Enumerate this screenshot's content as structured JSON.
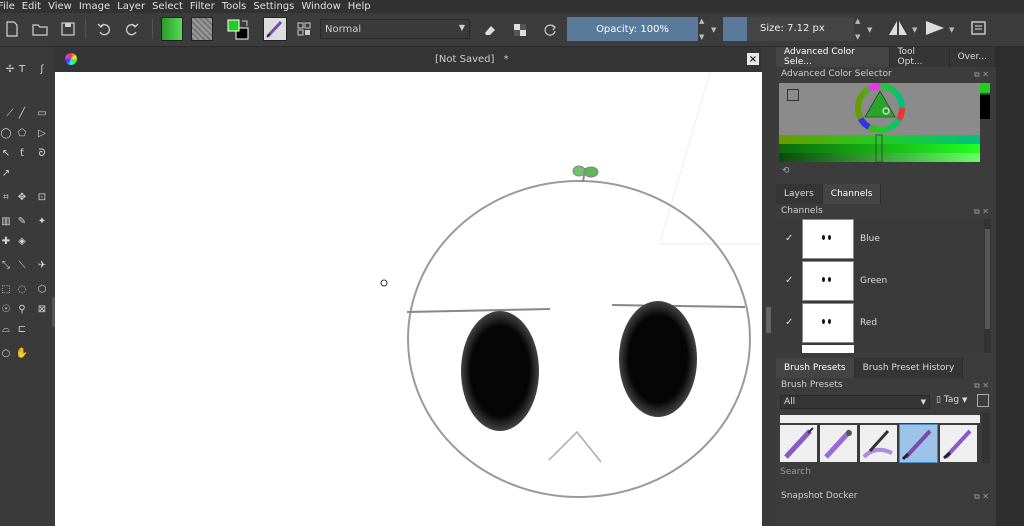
{
  "menu": [
    "File",
    "Edit",
    "View",
    "Image",
    "Layer",
    "Select",
    "Filter",
    "Tools",
    "Settings",
    "Window",
    "Help"
  ],
  "toolbar": {
    "blend_mode": "Normal",
    "opacity_label": "Opacity: 100%",
    "opacity_value": 100,
    "size_label": "Size: 7.12 px",
    "colors": {
      "foreground": "#22cc22",
      "background": "#000000"
    }
  },
  "canvas": {
    "title": "[Not Saved]",
    "modified_marker": "*"
  },
  "dock": {
    "top_tabs": [
      "Advanced Color Sele...",
      "Tool Opt...",
      "Over..."
    ],
    "color_selector_title": "Advanced Color Selector",
    "layer_tabs": [
      "Layers",
      "Channels"
    ],
    "channels_title": "Channels",
    "channels": [
      {
        "name": "Blue",
        "checked": true
      },
      {
        "name": "Green",
        "checked": true
      },
      {
        "name": "Red",
        "checked": true
      }
    ],
    "brush_tabs": [
      "Brush Presets",
      "Brush Preset History"
    ],
    "brush_presets_title": "Brush Presets",
    "brush_filter": "All",
    "tag_label": "Tag",
    "search_placeholder": "Search",
    "snapshot_title": "Snapshot Docker"
  }
}
